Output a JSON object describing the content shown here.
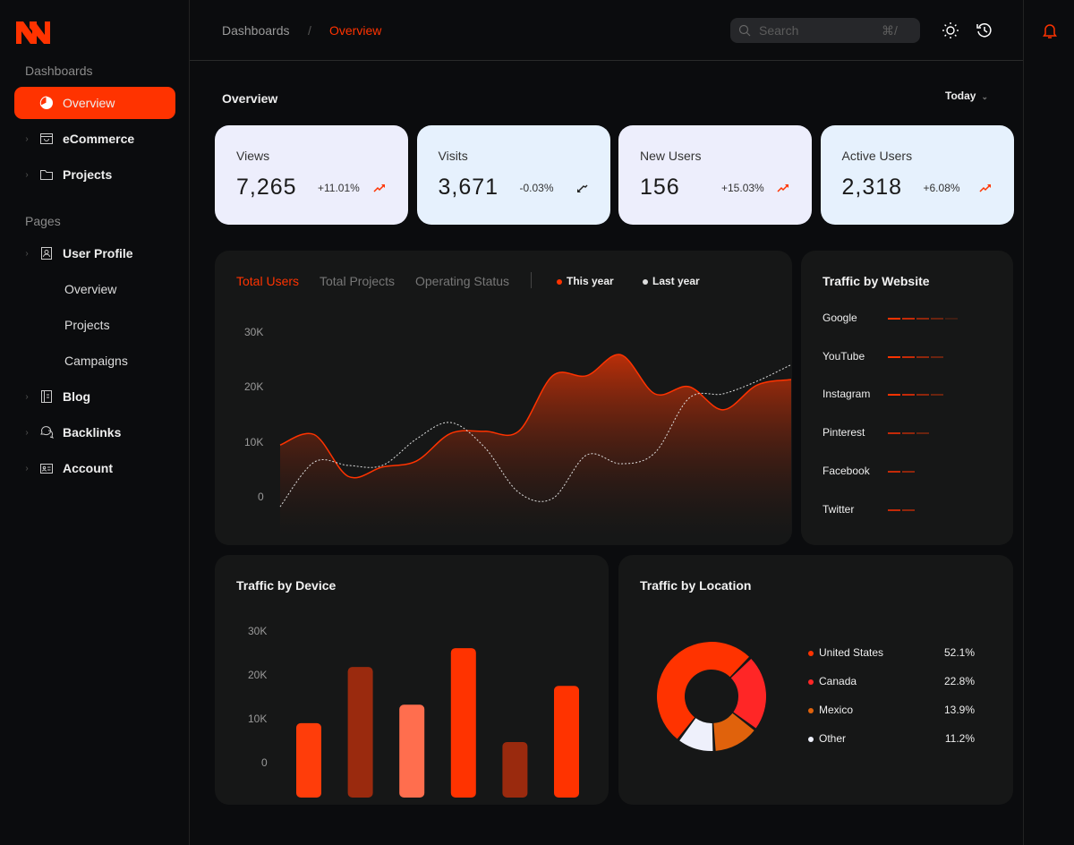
{
  "sidebar": {
    "logo": "N",
    "section_dashboards": "Dashboards",
    "dashboards": [
      {
        "label": "Overview",
        "icon": "pie-chart-icon",
        "active": true
      },
      {
        "label": "eCommerce",
        "icon": "shopping-bag-icon"
      },
      {
        "label": "Projects",
        "icon": "folder-icon"
      }
    ],
    "section_pages": "Pages",
    "pages": [
      {
        "label": "User Profile",
        "icon": "user-profile-icon"
      },
      {
        "label": "Blog",
        "icon": "book-icon"
      },
      {
        "label": "Backlinks",
        "icon": "chat-bubbles-icon"
      },
      {
        "label": "Account",
        "icon": "id-card-icon"
      }
    ],
    "user_profile_sub": [
      "Overview",
      "Projects",
      "Campaigns"
    ]
  },
  "header": {
    "breadcrumb": [
      "Dashboards",
      "Overview"
    ],
    "separator": "/",
    "search_placeholder": "Search",
    "search_shortcut": "⌘/"
  },
  "main": {
    "title": "Overview",
    "range": "Today"
  },
  "stats": [
    {
      "label": "Views",
      "value": "7,265",
      "change": "+11.01%",
      "trend": "up",
      "bg": "#edeefc"
    },
    {
      "label": "Visits",
      "value": "3,671",
      "change": "-0.03%",
      "trend": "down",
      "bg": "#e6f1fd"
    },
    {
      "label": "New Users",
      "value": "156",
      "change": "+15.03%",
      "trend": "up",
      "bg": "#edeefc"
    },
    {
      "label": "Active Users",
      "value": "2,318",
      "change": "+6.08%",
      "trend": "up",
      "bg": "#e6f1fd"
    }
  ],
  "colors": {
    "accent": "#ff3300",
    "card": "#161717",
    "bg": "#0b0c0e"
  },
  "chart_data": [
    {
      "type": "line",
      "tabs": [
        "Total Users",
        "Total Projects",
        "Operating Status"
      ],
      "active_tab": "Total Users",
      "yticks": [
        "30K",
        "20K",
        "10K",
        "0"
      ],
      "ylim": [
        0,
        30000
      ],
      "grid": false,
      "legend": "top",
      "series": [
        {
          "name": "This year",
          "style": "solid-area",
          "values": [
            9400,
            11300,
            3700,
            5400,
            6500,
            11500,
            11900,
            11900,
            22000,
            22000,
            25800,
            18700,
            20000,
            15800,
            20300,
            21300
          ]
        },
        {
          "name": "Last year",
          "style": "dashed",
          "values": [
            -1800,
            6300,
            5700,
            5700,
            10500,
            13500,
            9000,
            800,
            -300,
            7600,
            6000,
            8000,
            17900,
            18700,
            21000,
            24000
          ]
        }
      ]
    },
    {
      "type": "bar",
      "title": "Traffic by Device",
      "yticks": [
        "30K",
        "20K",
        "10K",
        "0"
      ],
      "ylim": [
        0,
        30000
      ],
      "values": [
        8800,
        21600,
        13000,
        25900,
        4500,
        17300
      ],
      "colors": [
        "#ff3d0a",
        "#9a2a0e",
        "#ff6e4e",
        "#ff3300",
        "#9a2a0e",
        "#ff3300"
      ]
    },
    {
      "type": "pie",
      "title": "Traffic by Location",
      "categories": [
        "United States",
        "Canada",
        "Mexico",
        "Other"
      ],
      "values": [
        52.1,
        22.8,
        13.9,
        11.2
      ],
      "labels": [
        "52.1%",
        "22.8%",
        "13.9%",
        "11.2%"
      ],
      "colors": [
        "#ff3300",
        "#ff2626",
        "#e0620c",
        "#eef0fb"
      ]
    }
  ],
  "traffic_website": {
    "title": "Traffic by Website",
    "sites": [
      {
        "name": "Google",
        "level": 5
      },
      {
        "name": "YouTube",
        "level": 4
      },
      {
        "name": "Instagram",
        "level": 4
      },
      {
        "name": "Pinterest",
        "level": 3
      },
      {
        "name": "Facebook",
        "level": 2
      },
      {
        "name": "Twitter",
        "level": 2
      }
    ]
  }
}
